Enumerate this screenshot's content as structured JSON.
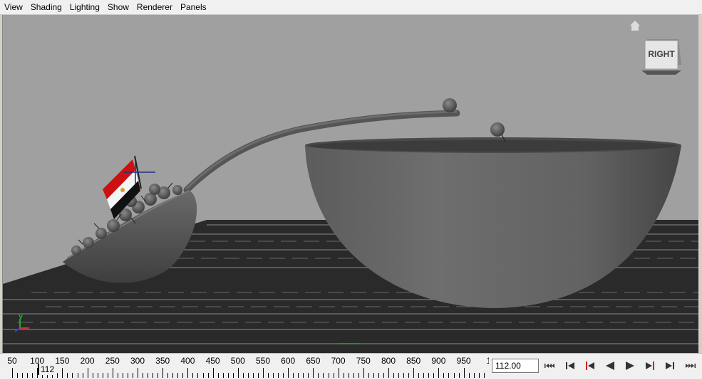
{
  "menu": [
    "View",
    "Shading",
    "Lighting",
    "Show",
    "Renderer",
    "Panels"
  ],
  "viewport": {
    "view_cube_label": "RIGHT",
    "axis_label": "y",
    "background_color": "#a0a0a0",
    "grid_color": "#1a1a1a",
    "mesh_color": "#5a5a5a"
  },
  "timeline": {
    "ticks": [
      "50",
      "100",
      "150",
      "200",
      "250",
      "300",
      "350",
      "400",
      "450",
      "500",
      "550",
      "600",
      "650",
      "700",
      "750",
      "800",
      "850",
      "900",
      "950",
      "1"
    ],
    "current_frame_marker": "112",
    "current_frame_value": "112.00",
    "playback_controls": [
      "go-to-start",
      "step-back-key",
      "step-back-frame",
      "play-backward",
      "play-forward",
      "step-forward-frame",
      "step-forward-key",
      "go-to-end"
    ]
  }
}
